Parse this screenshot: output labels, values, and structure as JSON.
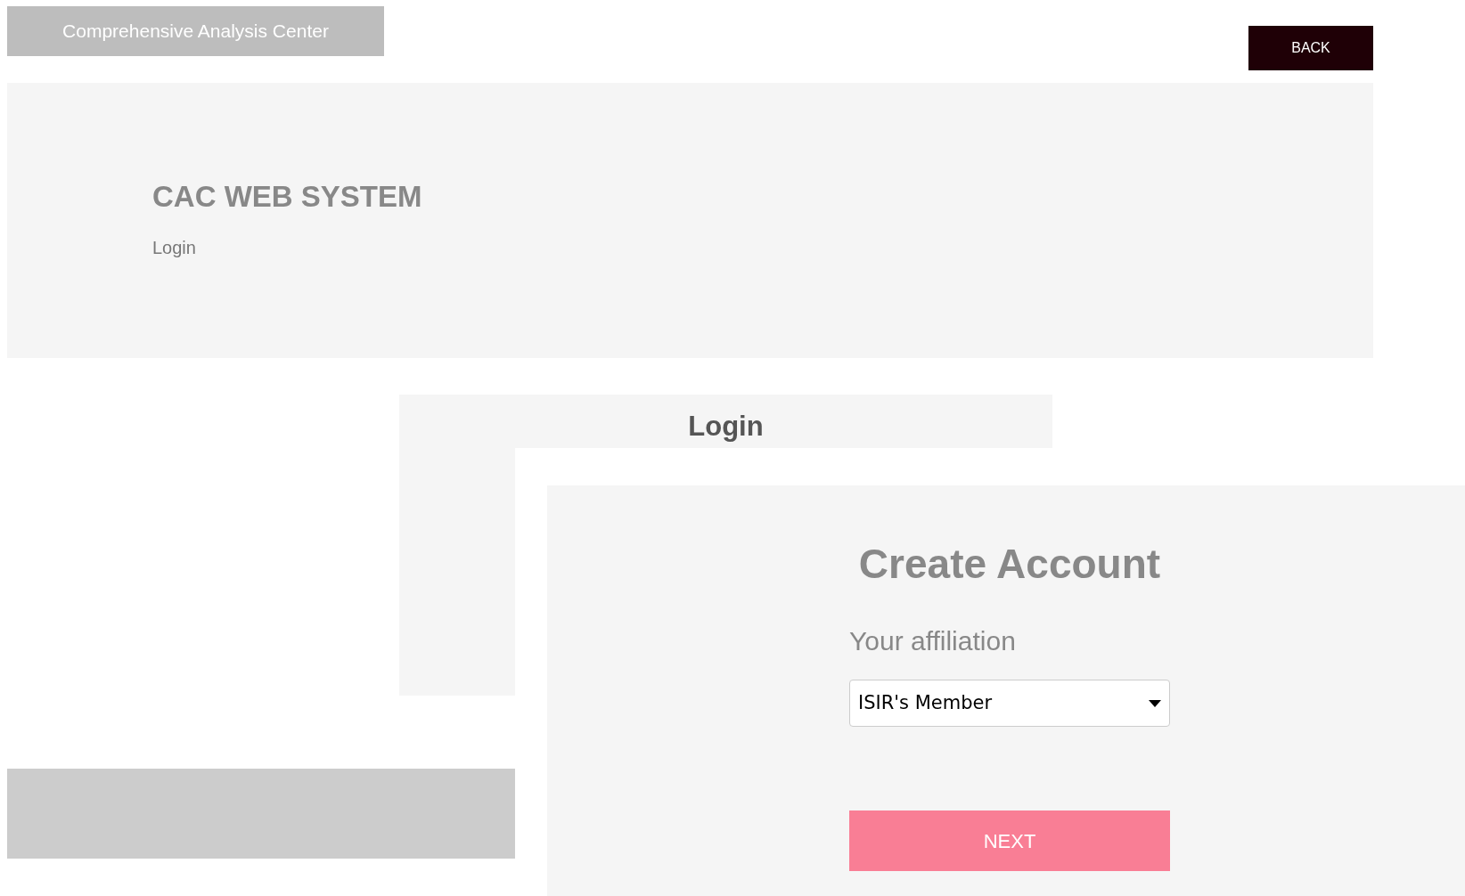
{
  "header": {
    "brand": "Comprehensive Analysis Center",
    "back_button": "BACK"
  },
  "hero": {
    "title": "CAC WEB SYSTEM",
    "subtitle": "Login"
  },
  "login_card": {
    "title": "Login"
  },
  "create_account": {
    "title": "Create Account",
    "affiliation_label": "Your affiliation",
    "affiliation_value": "ISIR's Member",
    "next_button": "NEXT"
  }
}
